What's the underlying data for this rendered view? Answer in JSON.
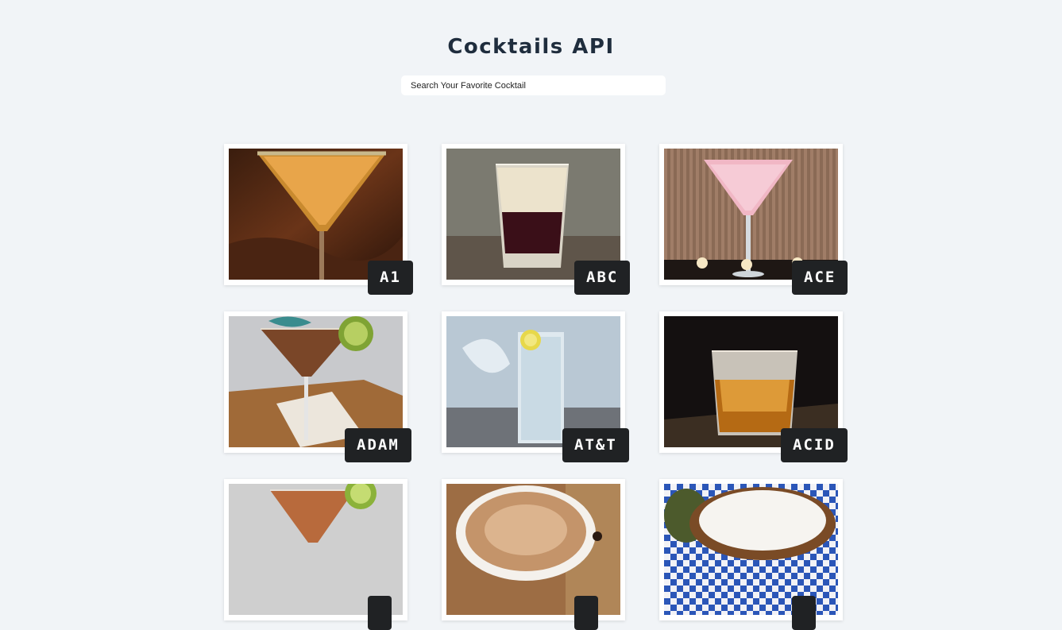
{
  "header": {
    "title": "Cocktails API"
  },
  "search": {
    "placeholder": "Search Your Favorite Cocktail",
    "value": ""
  },
  "cocktails": [
    {
      "name": "A1",
      "image": "orange-martini-sugar-rim"
    },
    {
      "name": "ABC",
      "image": "layered-shot-glass"
    },
    {
      "name": "ACE",
      "image": "pink-martini-candles"
    },
    {
      "name": "ADAM",
      "image": "martini-lime-umbrella"
    },
    {
      "name": "AT&T",
      "image": "highball-lemon-ice"
    },
    {
      "name": "ACID",
      "image": "whiskey-on-rocks"
    },
    {
      "name": "",
      "image": "martini-lime"
    },
    {
      "name": "",
      "image": "cappuccino-cup"
    },
    {
      "name": "",
      "image": "frothy-coffee-checked-cloth"
    }
  ]
}
